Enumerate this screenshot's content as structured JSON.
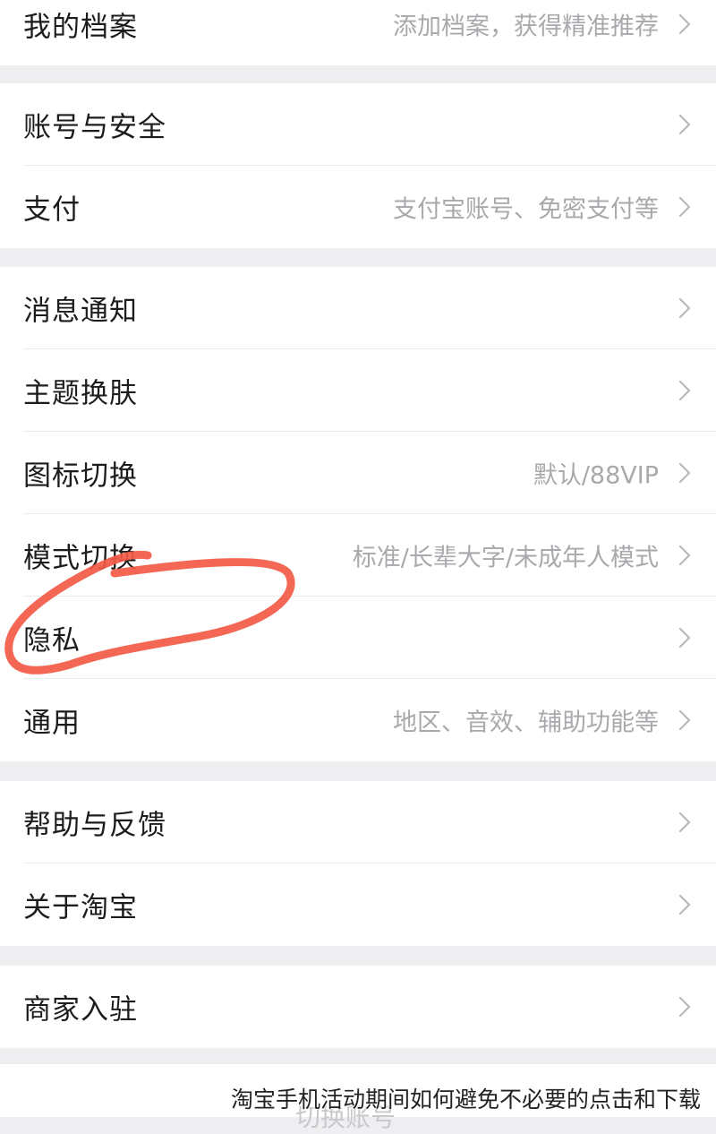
{
  "groups": [
    [
      {
        "label": "我的档案",
        "hint": "添加档案，获得精准推荐"
      }
    ],
    [
      {
        "label": "账号与安全",
        "hint": ""
      },
      {
        "label": "支付",
        "hint": "支付宝账号、免密支付等"
      }
    ],
    [
      {
        "label": "消息通知",
        "hint": ""
      },
      {
        "label": "主题换肤",
        "hint": ""
      },
      {
        "label": "图标切换",
        "hint": "默认/88VIP"
      },
      {
        "label": "模式切换",
        "hint": "标准/长辈大字/未成年人模式"
      },
      {
        "label": "隐私",
        "hint": ""
      },
      {
        "label": "通用",
        "hint": "地区、音效、辅助功能等"
      }
    ],
    [
      {
        "label": "帮助与反馈",
        "hint": ""
      },
      {
        "label": "关于淘宝",
        "hint": ""
      }
    ],
    [
      {
        "label": "商家入驻",
        "hint": ""
      }
    ]
  ],
  "footer": {
    "partial_button": "切换账号"
  },
  "caption": "淘宝手机活动期间如何避免不必要的点击和下载",
  "colors": {
    "annotation": "#f25a45",
    "background": "#efeff1",
    "hint": "#a9a9ad"
  },
  "icons": [
    "chevron-right-icon"
  ]
}
